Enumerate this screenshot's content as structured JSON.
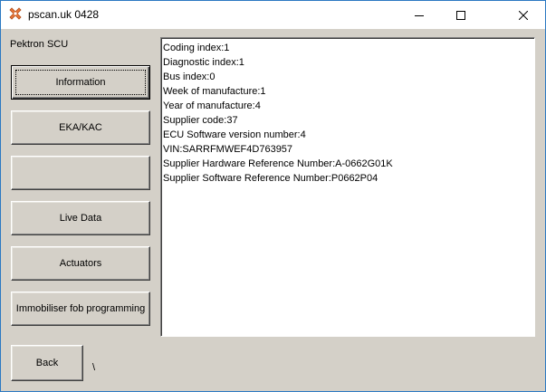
{
  "window": {
    "title": "pscan.uk 0428",
    "icon": "wrench-cross-icon",
    "accent_color": "#e8763a"
  },
  "module_label": "Pektron SCU",
  "buttons": {
    "information": "Information",
    "eka_kac": "EKA/KAC",
    "blank": "",
    "live_data": "Live Data",
    "actuators": "Actuators",
    "immobiliser": "Immobiliser fob programming",
    "back": "Back"
  },
  "status_char": "\\",
  "info_lines": [
    "Coding index:1",
    "Diagnostic index:1",
    "Bus index:0",
    "Week of manufacture:1",
    "Year of manufacture:4",
    "Supplier code:37",
    "ECU Software version number:4",
    "VIN:SARRFMWEF4D763957",
    "Supplier Hardware Reference Number:A-0662G01K",
    "Supplier Software Reference Number:P0662P04"
  ]
}
